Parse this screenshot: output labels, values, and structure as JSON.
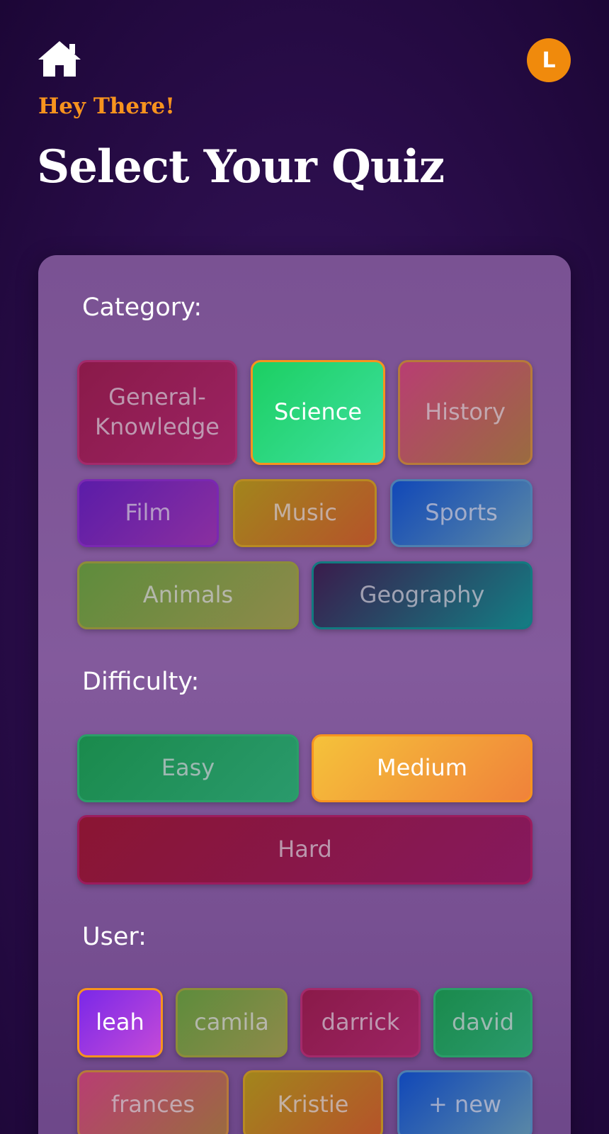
{
  "header": {
    "greeting": "Hey There!",
    "title": "Select Your Quiz",
    "avatar_initial": "L"
  },
  "category": {
    "label": "Category:",
    "items": [
      {
        "line1": "General-",
        "line2": "Knowledge",
        "selected": false
      },
      {
        "label": "Science",
        "selected": true
      },
      {
        "label": "History",
        "selected": false
      },
      {
        "label": "Film",
        "selected": false
      },
      {
        "label": "Music",
        "selected": false
      },
      {
        "label": "Sports",
        "selected": false
      },
      {
        "label": "Animals",
        "selected": false
      },
      {
        "label": "Geography",
        "selected": false
      }
    ]
  },
  "difficulty": {
    "label": "Difficulty:",
    "items": [
      {
        "label": "Easy",
        "selected": false
      },
      {
        "label": "Medium",
        "selected": true
      },
      {
        "label": "Hard",
        "selected": false
      }
    ]
  },
  "user": {
    "label": "User:",
    "items": [
      {
        "label": "leah",
        "selected": true
      },
      {
        "label": "camila",
        "selected": false
      },
      {
        "label": "darrick",
        "selected": false
      },
      {
        "label": "david",
        "selected": false
      },
      {
        "label": "frances",
        "selected": false
      },
      {
        "label": "Kristie",
        "selected": false
      },
      {
        "label": "+ new",
        "selected": false
      }
    ]
  },
  "colors": {
    "accent": "#f7931e",
    "avatar": "#f08a0c",
    "card": "#7a5293",
    "background": "#2a0d4a"
  }
}
